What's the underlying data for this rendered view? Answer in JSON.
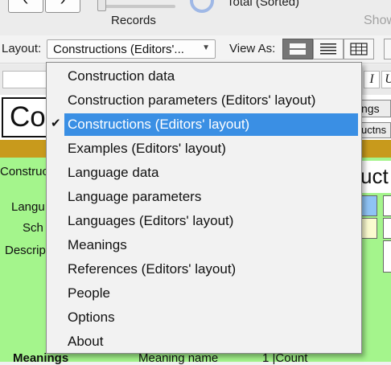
{
  "toolbar": {
    "records_label": "Records",
    "total_text": "Total (Sorted)",
    "show_text": "Show"
  },
  "layout_bar": {
    "layout_label": "Layout:",
    "selected_layout": "Constructions (Editors'...",
    "view_as_label": "View As:",
    "view_modes": [
      "form",
      "list",
      "table"
    ],
    "active_view": "form"
  },
  "form": {
    "big_title": "Co",
    "title_field_text": "uct",
    "tab_meanings": "ngs",
    "tab_constructions": "uctns",
    "labels": {
      "construction": "Construc",
      "language": "Langu",
      "scheme": "Sch",
      "description": "Descrip",
      "meanings": "Meanings",
      "meaning_name": "Meaning name",
      "count": "1  |Count"
    }
  },
  "menu": {
    "items": [
      "Construction data",
      "Construction parameters (Editors' layout)",
      "Constructions (Editors' layout)",
      "Examples (Editors' layout)",
      "Language data",
      "Language parameters",
      "Languages (Editors' layout)",
      "Meanings",
      "References (Editors' layout)",
      "People",
      "Options",
      "About"
    ],
    "selected_index": 2,
    "checkmark": "✔"
  },
  "colors": {
    "selection": "#3a8fe4",
    "form_background": "#a4f58c",
    "header_strip": "#c89a1c"
  }
}
